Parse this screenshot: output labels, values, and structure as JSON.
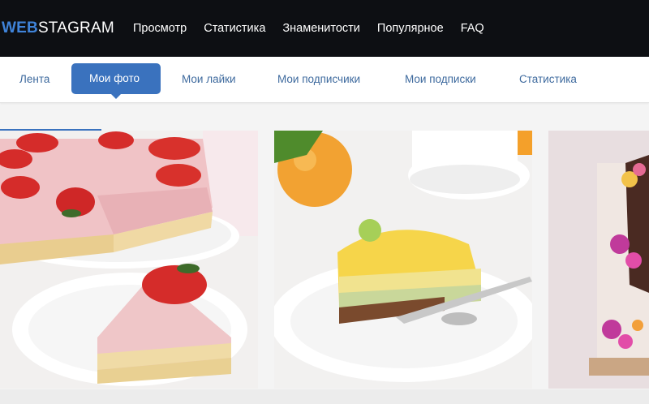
{
  "header": {
    "logo_accent": "WEB",
    "logo_rest": "STAGRAM",
    "nav": [
      "Просмотр",
      "Статистика",
      "Знаменитости",
      "Популярное",
      "FAQ"
    ]
  },
  "subnav": {
    "tabs": [
      "Лента",
      "Мои фото",
      "Мои лайки",
      "Мои подписчики",
      "Мои подписки",
      "Статистика"
    ],
    "active_index": 1
  },
  "photos": [
    {
      "name": "strawberry-mousse-cake-photo"
    },
    {
      "name": "citrus-mousse-cake-photo"
    },
    {
      "name": "decorated-tiered-cake-photo"
    }
  ],
  "colors": {
    "topbar": "#0d0f13",
    "accent": "#3a72be",
    "tab_text": "#3e6a9e"
  }
}
